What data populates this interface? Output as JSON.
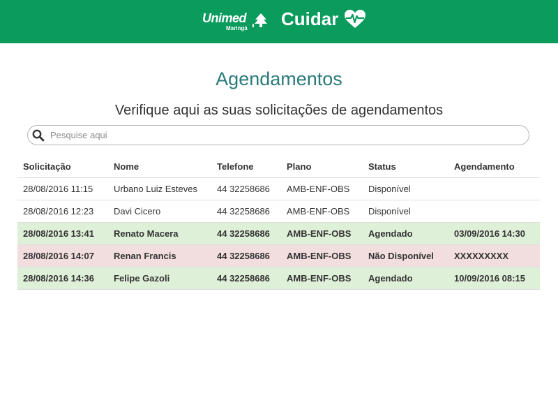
{
  "header": {
    "logo_text": "Unimed",
    "logo_subtext": "Maringá",
    "brand_title": "Cuidar",
    "background_color": "#0a9b5d"
  },
  "main": {
    "title": "Agendamentos",
    "subtitle": "Verifique aqui as suas solicitações de agendamentos"
  },
  "search": {
    "placeholder": "Pesquise aqui",
    "value": ""
  },
  "table": {
    "columns": [
      "Solicitação",
      "Nome",
      "Telefone",
      "Plano",
      "Status",
      "Agendamento"
    ],
    "rows": [
      {
        "solicitacao": "28/08/2016 11:15",
        "nome": "Urbano Luiz Esteves",
        "telefone": "44 32258686",
        "plano": "AMB-ENF-OBS",
        "status": "Disponível",
        "agendamento": ""
      },
      {
        "solicitacao": "28/08/2016 12:23",
        "nome": "Davi Cicero",
        "telefone": "44 32258686",
        "plano": "AMB-ENF-OBS",
        "status": "Disponível",
        "agendamento": ""
      },
      {
        "solicitacao": "28/08/2016 13:41",
        "nome": "Renato Macera",
        "telefone": "44 32258686",
        "plano": "AMB-ENF-OBS",
        "status": "Agendado",
        "agendamento": "03/09/2016 14:30"
      },
      {
        "solicitacao": "28/08/2016 14:07",
        "nome": "Renan Francis",
        "telefone": "44 32258686",
        "plano": "AMB-ENF-OBS",
        "status": "Não Disponível",
        "agendamento": "XXXXXXXXX"
      },
      {
        "solicitacao": "28/08/2016 14:36",
        "nome": "Felipe Gazoli",
        "telefone": "44 32258686",
        "plano": "AMB-ENF-OBS",
        "status": "Agendado",
        "agendamento": "10/09/2016 08:15"
      }
    ],
    "row_colors": {
      "scheduled": "#dff0d8",
      "unavailable": "#f2dede"
    }
  },
  "icons": {
    "logo": "unimed-tree-icon",
    "brand": "heart-pulse-icon",
    "search": "search-icon"
  }
}
